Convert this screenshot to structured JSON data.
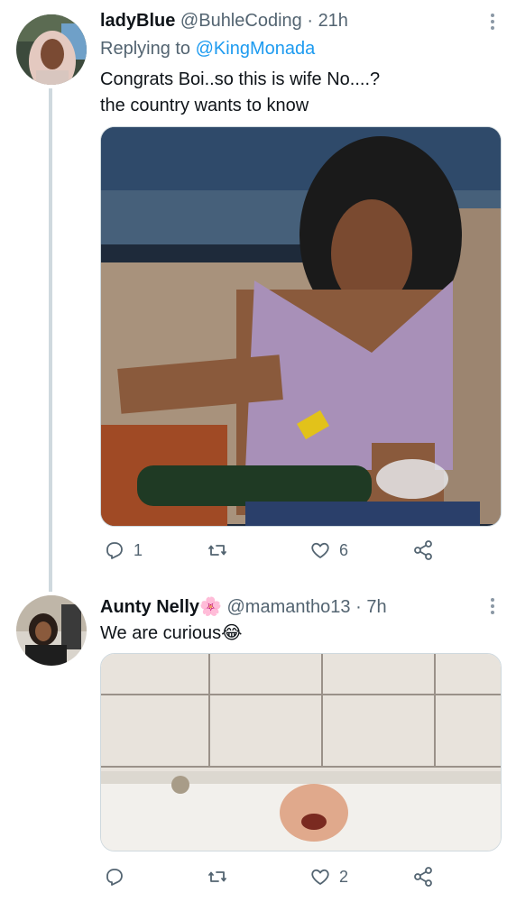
{
  "tweets": [
    {
      "display_name": "ladyBlue",
      "handle": "@BuhleCoding",
      "separator": "·",
      "time": "21h",
      "replying_prefix": "Replying to",
      "replying_to": "@KingMonada",
      "text_lines": [
        "Congrats Boi..so this is wife No....?",
        "the country wants to know"
      ],
      "actions": {
        "replies": "1",
        "retweets": "",
        "likes": "6"
      }
    },
    {
      "display_name": "Aunty Nelly",
      "name_emoji": "🌸",
      "handle": "@mamantho13",
      "separator": "·",
      "time": "7h",
      "text": "We are curious",
      "text_emoji": "😂",
      "actions": {
        "replies": "",
        "retweets": "",
        "likes": "2"
      }
    }
  ],
  "icons": [
    "reply-icon",
    "retweet-icon",
    "like-icon",
    "share-icon",
    "more-icon"
  ],
  "colors": {
    "link": "#1d9bf0",
    "meta": "#536471",
    "thread_line": "#cfd9de"
  }
}
